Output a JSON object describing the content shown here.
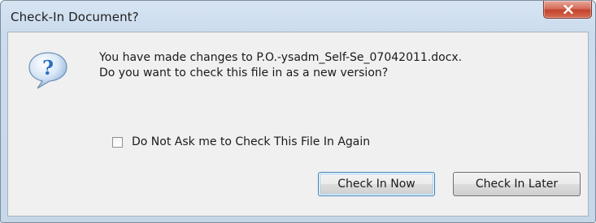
{
  "dialog": {
    "title": "Check-In Document?",
    "close_icon": "close-icon",
    "question_icon": "question-icon",
    "message_line1": "You have made changes to P.O.-ysadm_Self-Se_07042011.docx.",
    "message_line2": "Do you want to check this file in as a new version?",
    "checkbox_label": "Do Not Ask me to Check This File In Again",
    "checkbox_checked": false,
    "buttons": {
      "check_in_now": "Check In Now",
      "check_in_later": "Check In Later"
    }
  },
  "colors": {
    "titlebar": "#cbdcee",
    "client_background": "#f0f0f0",
    "close_button": "#c94a33",
    "default_button_border": "#3c7fb1",
    "question_icon": "#2a6fc2"
  }
}
